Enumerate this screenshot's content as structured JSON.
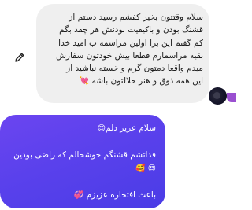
{
  "incoming_message": {
    "lines": [
      "سلام وقتتون بخیر کفشم رسید دستم از",
      "قشنگ بودن و باکیفیت بودنش هر چقد بگم",
      "کم گفتم این برا اولین مراسمه ب امید خدا",
      "بقیه مراسمارم قطعا بیش خودتون سفارش",
      "میدم واقعا دمتون گرم و خسته نباشید از",
      "این همه ذوق و هنر حلالتون باشه"
    ],
    "end_emoji": "💘"
  },
  "outgoing_message": {
    "greeting": "سلام عزیز دلم",
    "greeting_emoji": "😍",
    "line2": "فداتشم قشنگم خوشحالم که راضی بودین",
    "line3_emojis": "😍 🥰",
    "line4": "باعث افتخاره عزیزم",
    "line4_emoji": "💞"
  },
  "icons": {
    "edit": "pencil-icon",
    "avatar": "avatar"
  },
  "colors": {
    "incoming_bubble": "#efefef",
    "outgoing_bubble_start": "#6b45f0",
    "outgoing_bubble_end": "#4a3ce6",
    "outgoing_text": "#ffffff"
  }
}
